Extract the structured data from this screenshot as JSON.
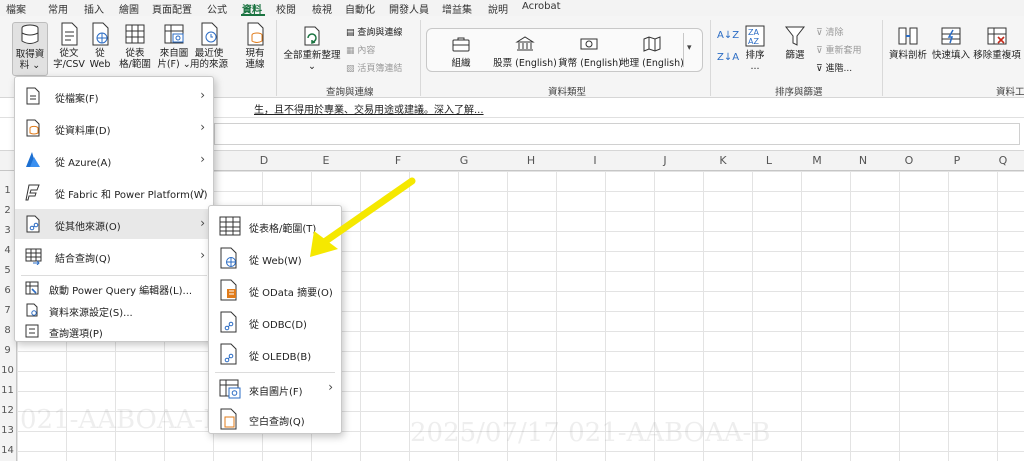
{
  "tabs": [
    "檔案",
    "常用",
    "插入",
    "繪圖",
    "頁面配置",
    "公式",
    "資料",
    "校閱",
    "檢視",
    "自動化",
    "開發人員",
    "增益集",
    "說明",
    "Acrobat"
  ],
  "active_tab": "資料",
  "ribbon": {
    "get_data": {
      "line1": "取得資",
      "line2": "料 ⌄"
    },
    "from_text": {
      "line1": "從文",
      "line2": "字/CSV"
    },
    "from_web": {
      "line1": "從",
      "line2": "Web"
    },
    "from_table": {
      "line1": "從表",
      "line2": "格/範圍"
    },
    "from_picture": {
      "line1": "來自圖",
      "line2": "片(F) ⌄"
    },
    "recent_sources": {
      "line1": "最近使",
      "line2": "用的來源"
    },
    "existing_conn": {
      "line1": "現有",
      "line2": "連線"
    },
    "refresh_all": {
      "line1": "全部重新整理",
      "line2": "⌄"
    },
    "queries_conn": "查詢與連線",
    "properties": "內容",
    "edit_links": "活頁簿連結",
    "group_queries": "查詢與連線",
    "data_types": {
      "org": "組織",
      "stocks": "股票 (English)",
      "currency": "貨幣 (English)",
      "geo": "地理 (English)"
    },
    "group_data_types": "資料類型",
    "sort_asc": "A↓Z",
    "sort_desc": "Z↓A",
    "sort": {
      "line1": "排序",
      "line2": "..."
    },
    "filter": "篩選",
    "clear": "清除",
    "reapply": "重新套用",
    "advanced": "進階...",
    "group_sort_filter": "排序與篩選",
    "text_to_columns": "資料剖析",
    "flash_fill": "快速填入",
    "remove_dup": "移除重複項",
    "group_tools": "資料工"
  },
  "infobar_text": "生，且不得用於專業、交易用途或建議。深入了解...",
  "columns": [
    "D",
    "E",
    "F",
    "G",
    "H",
    "I",
    "J",
    "K",
    "L",
    "M",
    "N",
    "O",
    "P",
    "Q"
  ],
  "rows": [
    "1",
    "2",
    "3",
    "4",
    "5",
    "6",
    "7",
    "8",
    "9",
    "10",
    "11",
    "12",
    "13",
    "14"
  ],
  "menu_main": {
    "items": [
      {
        "label": "從檔案(F)",
        "icon": "file-icon"
      },
      {
        "label": "從資料庫(D)",
        "icon": "database-icon"
      },
      {
        "label": "從 Azure(A)",
        "icon": "azure-icon"
      },
      {
        "label": "從 Fabric 和 Power Platform(W)",
        "icon": "fabric-icon"
      },
      {
        "label": "從其他來源(O)",
        "icon": "other-sources-icon"
      },
      {
        "label": "結合查詢(Q)",
        "icon": "combine-icon"
      }
    ],
    "extra": [
      {
        "label": "啟動 Power Query 編輯器(L)..."
      },
      {
        "label": "資料來源設定(S)..."
      },
      {
        "label": "查詢選項(P)"
      }
    ]
  },
  "menu_sub": {
    "items": [
      {
        "label": "從表格/範圍(T)"
      },
      {
        "label": "從 Web(W)"
      },
      {
        "label": "從 OData 摘要(O)"
      },
      {
        "label": "從 ODBC(D)"
      },
      {
        "label": "從 OLEDB(B)"
      },
      {
        "label": "來自圖片(F)"
      },
      {
        "label": "空白查詢(Q)"
      }
    ]
  },
  "watermark": {
    "line1": "021-AABOAA-B",
    "line2": "2025/07/17  021-AABOAA-B"
  },
  "colors": {
    "accent": "#1a7340",
    "arrow": "#f5e800",
    "highlight": "#e8e8e8"
  }
}
